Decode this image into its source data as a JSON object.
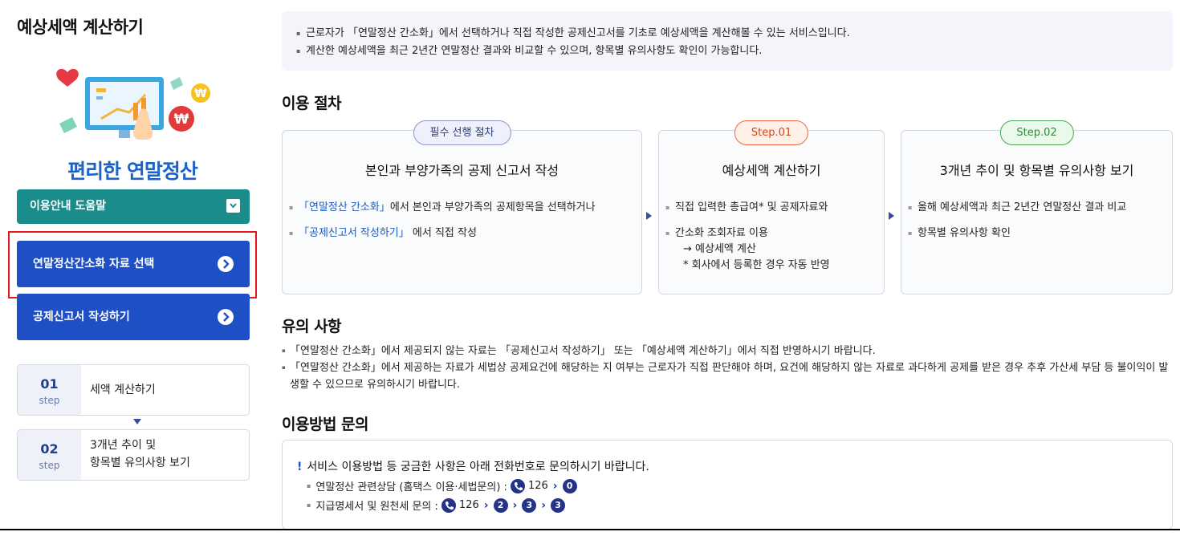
{
  "sidebar": {
    "title": "예상세액 계산하기",
    "brand": "편리한 연말정산",
    "help_label": "이용안내 도움말",
    "menu": [
      {
        "label": "연말정산간소화 자료 선택"
      },
      {
        "label": "공제신고서 작성하기"
      }
    ],
    "steps": [
      {
        "num": "01",
        "step": "step",
        "label": "세액 계산하기",
        "label2": ""
      },
      {
        "num": "02",
        "step": "step",
        "label": "3개년 추이 및",
        "label2": "항목별 유의사항 보기"
      }
    ]
  },
  "intro": {
    "lines": [
      "근로자가 「연말정산 간소화」에서 선택하거나 직접 작성한 공제신고서를 기초로 예상세액을 계산해볼 수 있는 서비스입니다.",
      "계산한 예상세액을 최근 2년간 연말정산 결과와 비교할 수 있으며, 항목별 유의사항도 확인이 가능합니다."
    ]
  },
  "procedure": {
    "heading": "이용 절차",
    "cards": [
      {
        "badge": "필수 선행 절차",
        "title": "본인과 부양가족의 공제 신고서 작성",
        "items": [
          {
            "link": "「연말정산 간소화」",
            "text": "에서 본인과 부양가족의 공제항목을 선택하거나"
          },
          {
            "link": "「공제신고서 작성하기」",
            "text": " 에서 직접 작성"
          }
        ]
      },
      {
        "badge": "Step.01",
        "title": "예상세액 계산하기",
        "items": [
          {
            "text": "직접 입력한 총급여* 및 공제자료와"
          },
          {
            "text": "간소화 조회자료 이용",
            "sub1": "→ 예상세액 계산",
            "sub2": "* 회사에서 등록한 경우 자동 반영"
          }
        ]
      },
      {
        "badge": "Step.02",
        "title": "3개년 추이 및 항목별 유의사항 보기",
        "items": [
          {
            "text": "올해 예상세액과 최근 2년간 연말정산 결과 비교"
          },
          {
            "text": "항목별 유의사항 확인"
          }
        ]
      }
    ]
  },
  "notes": {
    "heading": "유의 사항",
    "lines": [
      "「연말정산 간소화」에서 제공되지 않는 자료는 「공제신고서 작성하기」 또는 「예상세액 계산하기」에서 직접 반영하시기 바랍니다.",
      "「연말정산 간소화」에서 제공하는 자료가 세법상 공제요건에 해당하는 지 여부는 근로자가 직접 판단해야 하며, 요건에 해당하지 않는 자료로 과다하게 공제를 받은 경우 추후 가산세 부담 등 불이익이 발생할 수 있으므로 유의하시기 바랍니다."
    ]
  },
  "contact": {
    "heading": "이용방법 문의",
    "lead_mark": "!",
    "lead": "서비스 이용방법 등 궁금한 사항은 아래 전화번호로 문의하시기 바랍니다.",
    "rows": [
      {
        "label": "연말정산 관련상담 (홈택스 이용·세법문의) :",
        "phone": "126",
        "steps": [
          "0"
        ]
      },
      {
        "label": "지급명세서 및 원천세 문의 :",
        "phone": "126",
        "steps": [
          "2",
          "3",
          "3"
        ]
      }
    ]
  },
  "colors": {
    "teal": "#1a8c8c",
    "menu_blue": "#1f4fc4",
    "brand_blue": "#1d63c7",
    "highlight_red": "#e8151b",
    "navy": "#23338a"
  }
}
